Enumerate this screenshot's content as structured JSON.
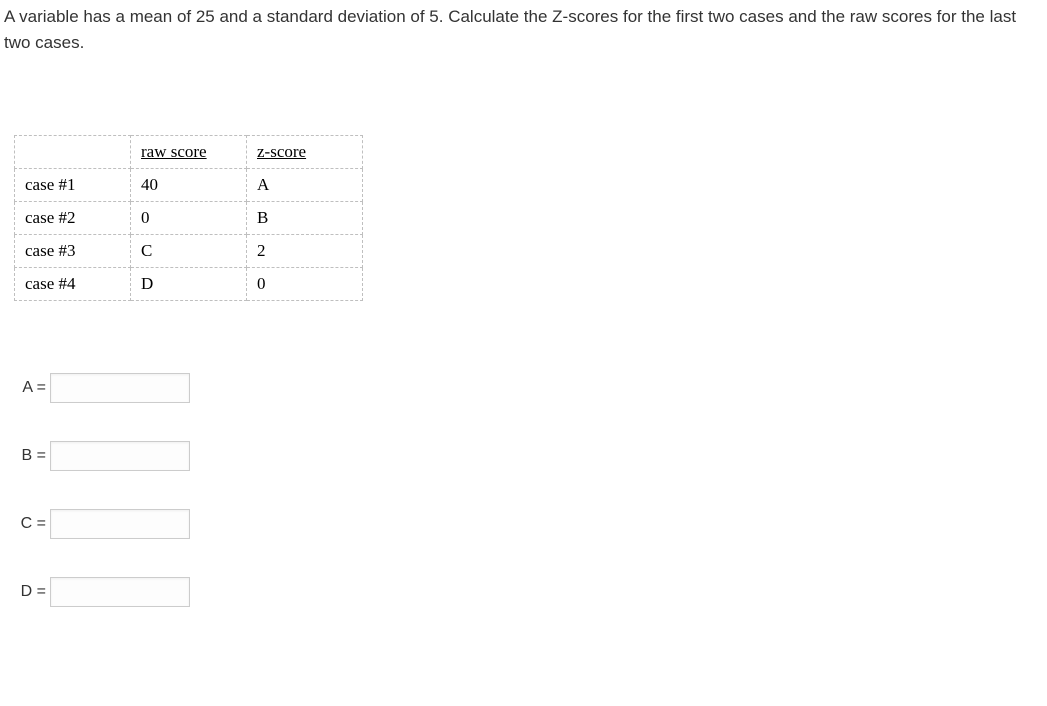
{
  "question": "A variable has a mean of 25 and a standard deviation of 5.  Calculate the Z-scores for the first two cases and the raw scores for the last two cases.",
  "table": {
    "headers": {
      "col1": "",
      "col2": "raw score",
      "col3": "z-score"
    },
    "rows": [
      {
        "case": "case #1",
        "raw": "40",
        "z": "A"
      },
      {
        "case": "case #2",
        "raw": "0",
        "z": "B"
      },
      {
        "case": "case #3",
        "raw": "C",
        "z": "2"
      },
      {
        "case": "case #4",
        "raw": "D",
        "z": "0"
      }
    ]
  },
  "answers": [
    {
      "label": "A =",
      "value": ""
    },
    {
      "label": "B =",
      "value": ""
    },
    {
      "label": "C =",
      "value": ""
    },
    {
      "label": "D =",
      "value": ""
    }
  ]
}
